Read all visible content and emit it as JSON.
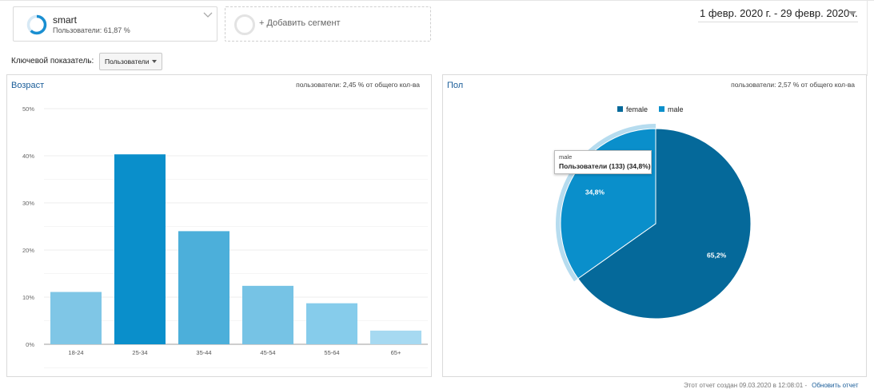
{
  "segment": {
    "name": "smart",
    "subtitle": "Пользователи: 61,87 %",
    "ring_fraction": 0.6187,
    "ring_color": "#1a8fd1"
  },
  "add_segment": {
    "label": "+ Добавить сегмент"
  },
  "date_range": {
    "label": "1 февр. 2020 г. - 29 февр. 2020 г."
  },
  "metric": {
    "label": "Ключевой показатель:",
    "selected": "Пользователи"
  },
  "age_panel": {
    "title": "Возраст",
    "summary": "пользователи: 2,45 % от общего кол-ва"
  },
  "gender_panel": {
    "title": "Пол",
    "summary": "пользователи: 2,57 % от общего кол-ва"
  },
  "tooltip": {
    "title": "male",
    "line": "Пользователи (133) (34,8%)"
  },
  "footer": {
    "text": "Этот отчет создан 09.03.2020 в 12:08:01 -",
    "link": "Обновить отчет"
  },
  "chart_data": [
    {
      "type": "bar",
      "title": "Возраст",
      "categories": [
        "18-24",
        "25-34",
        "35-44",
        "45-54",
        "55-64",
        "65+"
      ],
      "values": [
        11.1,
        40.3,
        24.0,
        12.4,
        8.7,
        2.9
      ],
      "unit": "%",
      "ylim": [
        0,
        50
      ],
      "yticks": [
        "0%",
        "10%",
        "20%",
        "30%",
        "40%",
        "50%"
      ],
      "grid": true,
      "colors": [
        "#7fc6e6",
        "#0a8fcb",
        "#4cafda",
        "#76c3e5",
        "#86cceb",
        "#a6d9f1"
      ]
    },
    {
      "type": "pie",
      "title": "Пол",
      "legend": [
        "female",
        "male"
      ],
      "legend_position": "top",
      "values": [
        65.2,
        34.8
      ],
      "labels": [
        "65,2%",
        "34,8%"
      ],
      "colors": [
        "#05699a",
        "#0a8fcb"
      ],
      "highlighted": "male"
    }
  ]
}
